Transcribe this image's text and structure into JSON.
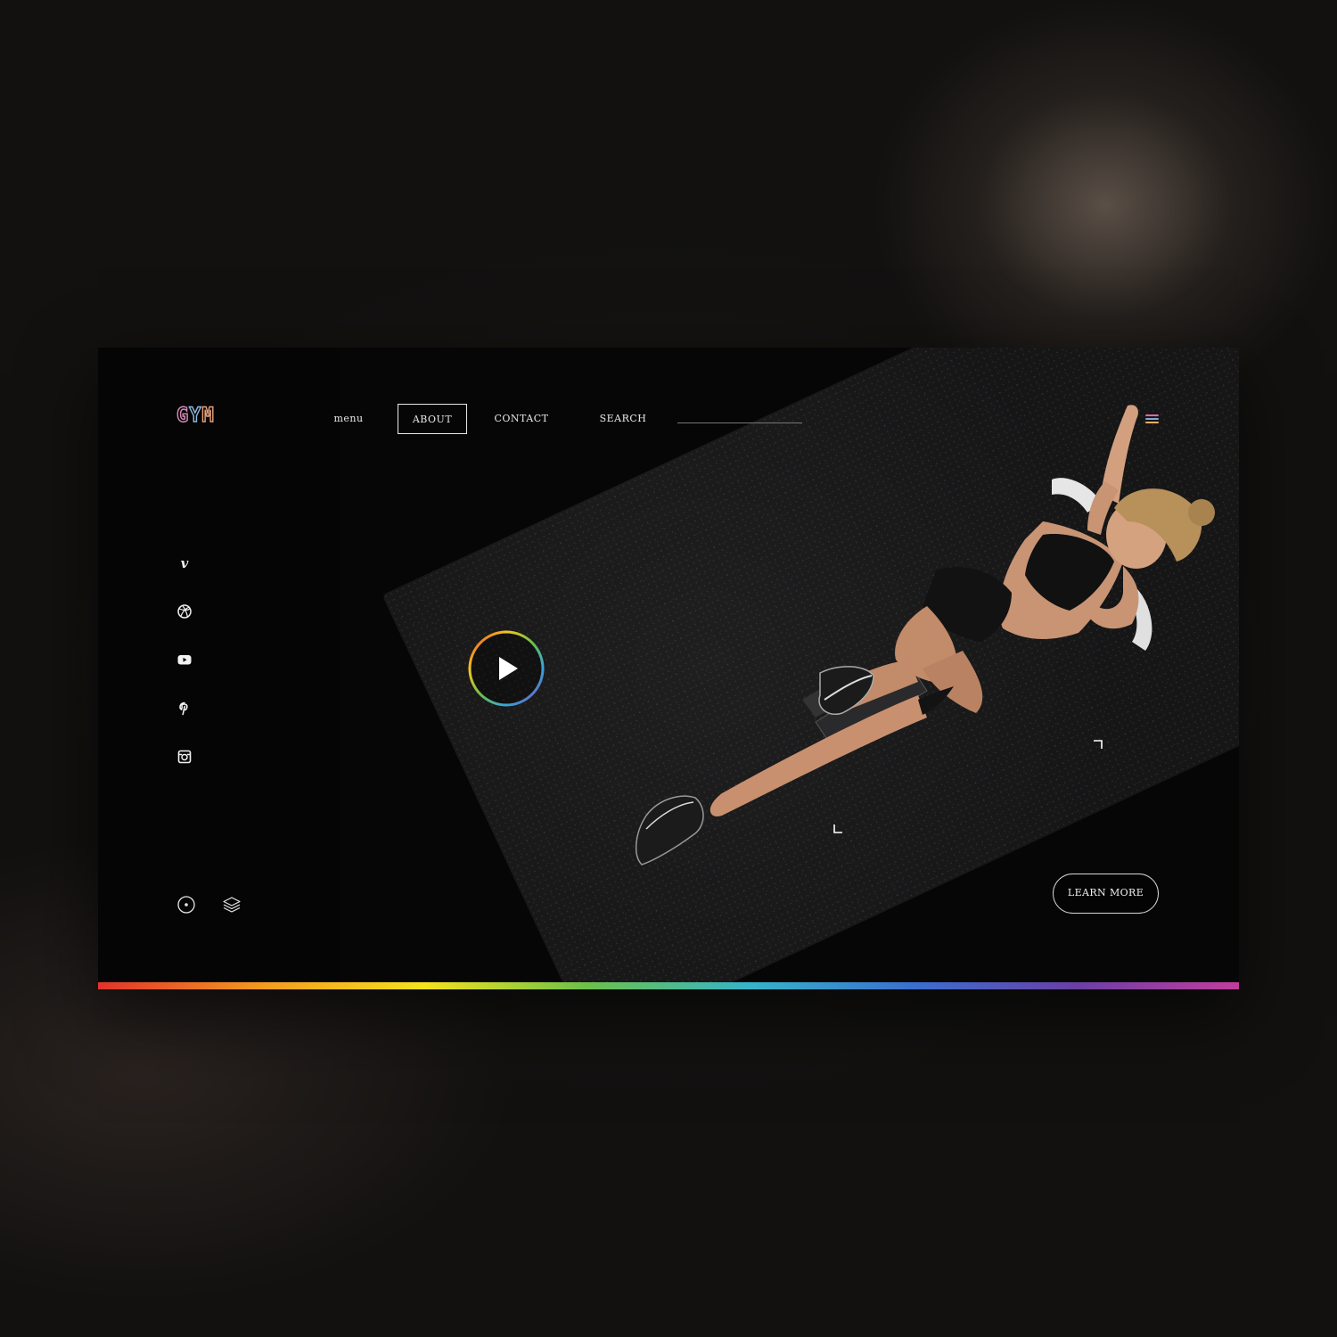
{
  "brand": {
    "logo": "GYM",
    "logo_letters": [
      "G",
      "Y",
      "M"
    ],
    "gradient_colors": [
      "#e1332c",
      "#f39a1f",
      "#f5e21d",
      "#6cc04a",
      "#36b4c9",
      "#3a6fcf",
      "#6a3fa6",
      "#c23d9d"
    ]
  },
  "nav": {
    "items": [
      {
        "label": "menu",
        "active": false
      },
      {
        "label": "ABOUT",
        "active": true
      },
      {
        "label": "CONTACT",
        "active": false
      },
      {
        "label": "SEARCH",
        "active": false
      }
    ]
  },
  "header": {
    "menu_icon": "hamburger-icon"
  },
  "social": [
    {
      "icon": "vimeo-icon"
    },
    {
      "icon": "dribbble-icon"
    },
    {
      "icon": "youtube-icon"
    },
    {
      "icon": "pinterest-icon"
    },
    {
      "icon": "instagram-icon"
    }
  ],
  "footer_icons": [
    {
      "icon": "record-icon"
    },
    {
      "icon": "layers-icon"
    }
  ],
  "hero": {
    "play_icon": "play-icon",
    "cta_label": "LEARN MORE"
  }
}
